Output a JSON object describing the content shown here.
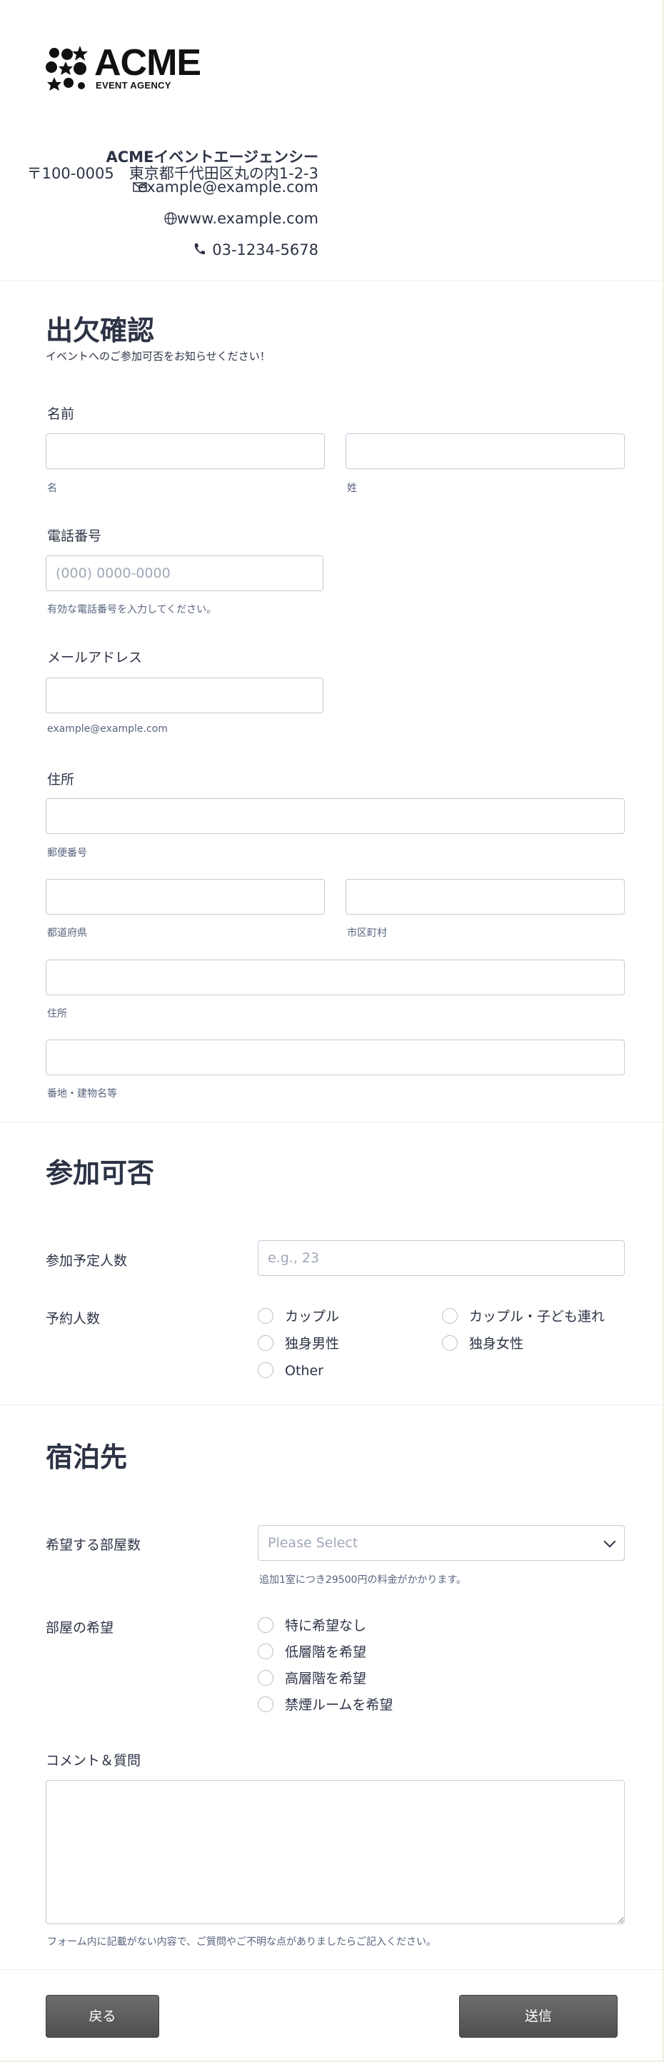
{
  "header": {
    "logo": {
      "word": "ACME",
      "subtitle": "EVENT AGENCY"
    },
    "company": "ACMEイベントエージェンシー",
    "address": "〒100-0005　東京都千代田区丸の内1-2-3",
    "email": "example@example.com",
    "website": "www.example.com",
    "phone": "03-1234-5678",
    "icons": {
      "email": "envelope-icon",
      "website": "globe-icon",
      "phone": "phone-icon"
    }
  },
  "rsvp": {
    "title": "出欠確認",
    "subtitle": "イベントへのご参加可否をお知らせください！",
    "name": {
      "label": "名前",
      "first_hint": "名",
      "last_hint": "姓",
      "first_value": "",
      "last_value": ""
    },
    "phone": {
      "label": "電話番号",
      "placeholder": "(000) 0000-0000",
      "hint": "有効な電話番号を入力してください。"
    },
    "email": {
      "label": "メールアドレス",
      "placeholder": "",
      "hint": "example@example.com"
    },
    "address": {
      "label": "住所",
      "postal_hint": "郵便番号",
      "prefecture_hint": "都道府県",
      "city_hint": "市区町村",
      "street_hint": "住所",
      "building_hint": "番地・建物名等"
    }
  },
  "attendance": {
    "title": "参加可否",
    "count_label": "参加予定人数",
    "count_placeholder": "e.g., 23",
    "reservation_label": "予約人数",
    "options": [
      "カップル",
      "カップル・子ども連れ",
      "独身男性",
      "独身女性",
      "Other"
    ]
  },
  "lodging": {
    "title": "宿泊先",
    "rooms_label": "希望する部屋数",
    "rooms_placeholder": "Please Select",
    "rooms_hint": "追加1室につき29500円の料金がかかります。",
    "pref_label": "部屋の希望",
    "pref_options": [
      "特に希望なし",
      "低層階を希望",
      "高層階を希望",
      "禁煙ルームを希望"
    ],
    "comments_label": "コメント＆質問",
    "comments_hint": "フォーム内に記載がない内容で、ご質問やご不明な点がありましたらご記入ください。"
  },
  "footer": {
    "back_label": "戻る",
    "submit_label": "送信"
  }
}
